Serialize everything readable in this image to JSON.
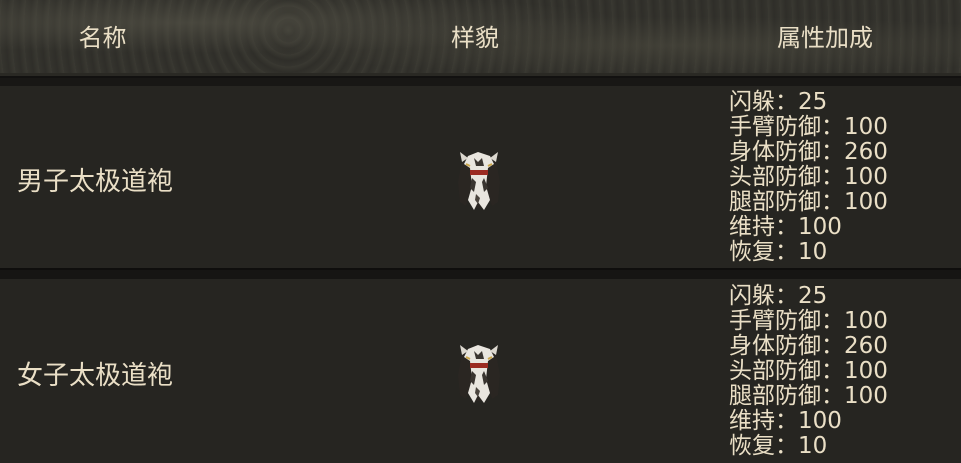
{
  "columns": {
    "name": "名称",
    "appearance": "样貌",
    "attributes": "属性加成"
  },
  "items": [
    {
      "name": "男子太极道袍",
      "sprite_icon": "robe-sprite-icon",
      "attributes": [
        "闪躲：25",
        "手臂防御：100",
        "身体防御：260",
        "头部防御：100",
        "腿部防御：100",
        "维持：100",
        "恢复：10"
      ]
    },
    {
      "name": "女子太极道袍",
      "sprite_icon": "robe-sprite-icon",
      "attributes": [
        "闪躲：25",
        "手臂防御：100",
        "身体防御：260",
        "头部防御：100",
        "腿部防御：100",
        "维持：100",
        "恢复：10"
      ]
    }
  ]
}
